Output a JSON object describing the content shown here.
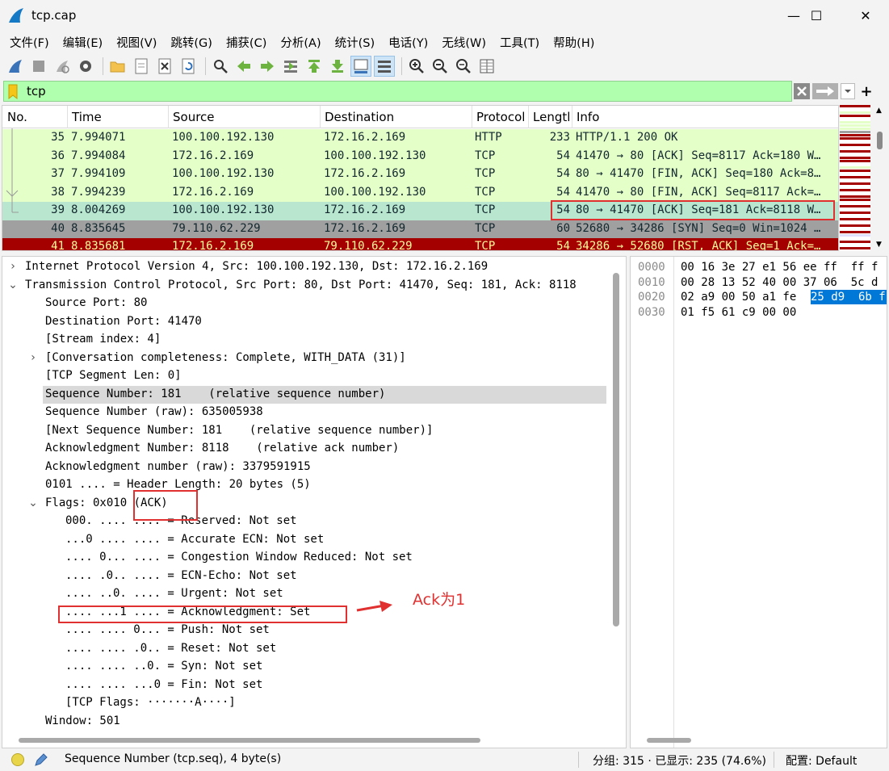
{
  "window": {
    "title": "tcp.cap",
    "minimize": "—",
    "maximize": "☐",
    "close": "✕"
  },
  "menu": [
    "文件(F)",
    "编辑(E)",
    "视图(V)",
    "跳转(G)",
    "捕获(C)",
    "分析(A)",
    "统计(S)",
    "电话(Y)",
    "无线(W)",
    "工具(T)",
    "帮助(H)"
  ],
  "filter": {
    "value": "tcp",
    "color": "#afffaf"
  },
  "columns": [
    "No.",
    "Time",
    "Source",
    "Destination",
    "Protocol",
    "Lengtl",
    "Info"
  ],
  "packets": [
    {
      "no": "35",
      "time": "7.994071",
      "src": "100.100.192.130",
      "dst": "172.16.2.169",
      "proto": "HTTP",
      "len": "233",
      "info": "HTTP/1.1 200 OK",
      "bg": "#e4ffc7",
      "fg": "#12272e"
    },
    {
      "no": "36",
      "time": "7.994084",
      "src": "172.16.2.169",
      "dst": "100.100.192.130",
      "proto": "TCP",
      "len": "54",
      "info": "41470 → 80 [ACK] Seq=8117 Ack=180 W…",
      "bg": "#e4ffc7",
      "fg": "#12272e"
    },
    {
      "no": "37",
      "time": "7.994109",
      "src": "100.100.192.130",
      "dst": "172.16.2.169",
      "proto": "TCP",
      "len": "54",
      "info": "80 → 41470 [FIN, ACK] Seq=180 Ack=8…",
      "bg": "#e4ffc7",
      "fg": "#12272e"
    },
    {
      "no": "38",
      "time": "7.994239",
      "src": "172.16.2.169",
      "dst": "100.100.192.130",
      "proto": "TCP",
      "len": "54",
      "info": "41470 → 80 [FIN, ACK] Seq=8117 Ack=…",
      "bg": "#e4ffc7",
      "fg": "#12272e"
    },
    {
      "no": "39",
      "time": "8.004269",
      "src": "100.100.192.130",
      "dst": "172.16.2.169",
      "proto": "TCP",
      "len": "54",
      "info": "80 → 41470 [ACK] Seq=181 Ack=8118 W…",
      "bg": "#b8e6cf",
      "fg": "#12272e"
    },
    {
      "no": "40",
      "time": "8.835645",
      "src": "79.110.62.229",
      "dst": "172.16.2.169",
      "proto": "TCP",
      "len": "60",
      "info": "52680 → 34286 [SYN] Seq=0 Win=1024 …",
      "bg": "#a0a0a0",
      "fg": "#12272e"
    },
    {
      "no": "41",
      "time": "8.835681",
      "src": "172.16.2.169",
      "dst": "79.110.62.229",
      "proto": "TCP",
      "len": "54",
      "info": "34286 → 52680 [RST, ACK] Seq=1 Ack=…",
      "bg": "#a40000",
      "fg": "#fffc9c"
    }
  ],
  "detail": [
    {
      "text": "Internet Protocol Version 4, Src: 100.100.192.130, Dst: 172.16.2.169",
      "indent": 0,
      "arrow": "›"
    },
    {
      "text": "Transmission Control Protocol, Src Port: 80, Dst Port: 41470, Seq: 181, Ack: 8118",
      "indent": 0,
      "arrow": "⌄"
    },
    {
      "text": "Source Port: 80",
      "indent": 1,
      "arrow": ""
    },
    {
      "text": "Destination Port: 41470",
      "indent": 1,
      "arrow": ""
    },
    {
      "text": "[Stream index: 4]",
      "indent": 1,
      "arrow": ""
    },
    {
      "text": "[Conversation completeness: Complete, WITH_DATA (31)]",
      "indent": 1,
      "arrow": "›"
    },
    {
      "text": "[TCP Segment Len: 0]",
      "indent": 1,
      "arrow": ""
    },
    {
      "text": "Sequence Number: 181    (relative sequence number)",
      "indent": 1,
      "arrow": "",
      "selected": true
    },
    {
      "text": "Sequence Number (raw): 635005938",
      "indent": 1,
      "arrow": ""
    },
    {
      "text": "[Next Sequence Number: 181    (relative sequence number)]",
      "indent": 1,
      "arrow": ""
    },
    {
      "text": "Acknowledgment Number: 8118    (relative ack number)",
      "indent": 1,
      "arrow": ""
    },
    {
      "text": "Acknowledgment number (raw): 3379591915",
      "indent": 1,
      "arrow": ""
    },
    {
      "text": "0101 .... = Header Length: 20 bytes (5)",
      "indent": 1,
      "arrow": ""
    },
    {
      "text": "Flags: 0x010 (ACK)",
      "indent": 1,
      "arrow": "⌄"
    },
    {
      "text": "000. .... .... = Reserved: Not set",
      "indent": 2,
      "arrow": ""
    },
    {
      "text": "...0 .... .... = Accurate ECN: Not set",
      "indent": 2,
      "arrow": ""
    },
    {
      "text": ".... 0... .... = Congestion Window Reduced: Not set",
      "indent": 2,
      "arrow": ""
    },
    {
      "text": ".... .0.. .... = ECN-Echo: Not set",
      "indent": 2,
      "arrow": ""
    },
    {
      "text": ".... ..0. .... = Urgent: Not set",
      "indent": 2,
      "arrow": ""
    },
    {
      "text": ".... ...1 .... = Acknowledgment: Set",
      "indent": 2,
      "arrow": ""
    },
    {
      "text": ".... .... 0... = Push: Not set",
      "indent": 2,
      "arrow": ""
    },
    {
      "text": ".... .... .0.. = Reset: Not set",
      "indent": 2,
      "arrow": ""
    },
    {
      "text": ".... .... ..0. = Syn: Not set",
      "indent": 2,
      "arrow": ""
    },
    {
      "text": ".... .... ...0 = Fin: Not set",
      "indent": 2,
      "arrow": ""
    },
    {
      "text": "[TCP Flags: ·······A····]",
      "indent": 2,
      "arrow": ""
    },
    {
      "text": "Window: 501",
      "indent": 1,
      "arrow": ""
    }
  ],
  "bytes": [
    {
      "offset": "0000",
      "hex": "00 16 3e 27 e1 56 ee ff  ff f"
    },
    {
      "offset": "0010",
      "hex": "00 28 13 52 40 00 37 06  5c d"
    },
    {
      "offset": "0020",
      "hex_pre": "02 a9 00 50 a1 fe ",
      "hex_sel": "25 d9  6b f"
    },
    {
      "offset": "0030",
      "hex": "01 f5 61 c9 00 00"
    }
  ],
  "annotation": {
    "text": "Ack为1",
    "color": "#e03030"
  },
  "status": {
    "field": "Sequence Number (tcp.seq), 4 byte(s)",
    "packets": "分组: 315 · 已显示: 235 (74.6%)",
    "profile": "配置: Default"
  }
}
